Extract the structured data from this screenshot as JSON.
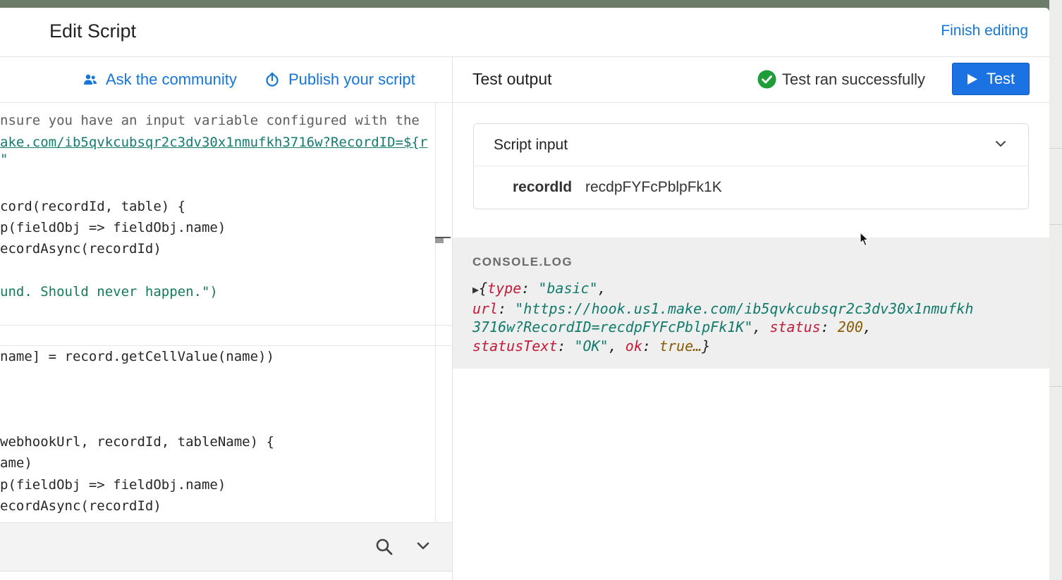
{
  "header": {
    "title": "Edit Script",
    "finish_label": "Finish editing"
  },
  "toolbar": {
    "community_label": "Ask the community",
    "publish_label": "Publish your script"
  },
  "code_lines": [
    "nsure you have an input variable configured with the",
    "ake.com/ib5qvkcubsqr2c3dv30x1nmufkh3716w?RecordID=${r",
    "\"",
    "cord(recordId, table) {",
    "p(fieldObj => fieldObj.name)",
    "ecordAsync(recordId)",
    "und. Should never happen.\")",
    "name] = record.getCellValue(name))",
    "webhookUrl, recordId, tableName) {",
    "ame)",
    "p(fieldObj => fieldObj.name)",
    "ecordAsync(recordId)"
  ],
  "output": {
    "title": "Test output",
    "status_text": "Test ran successfully",
    "test_button": "Test"
  },
  "script_input": {
    "title": "Script input",
    "var_name": "recordId",
    "var_value": "recdpFYFcPblpFk1K"
  },
  "console": {
    "label": "CONSOLE.LOG",
    "l1_open": "{",
    "l1_key": "type",
    "l1_colon": ": ",
    "l1_val": "\"basic\"",
    "l1_end": ",",
    "l2_key": "url",
    "l2_colon": ": ",
    "l2_val": "\"https://hook.us1.make.com/ib5qvkcubsqr2c3dv30x1nmufkh",
    "l3_val": "3716w?RecordID=recdpFYFcPblpFk1K\"",
    "l3_sep": ", ",
    "l3_key": "status",
    "l3_colon": ": ",
    "l3_num": "200",
    "l3_end": ",",
    "l4_key": "statusText",
    "l4_colon": ": ",
    "l4_val": "\"OK\"",
    "l4_sep": ", ",
    "l4_key2": "ok",
    "l4_colon2": ": ",
    "l4_val2": "true…",
    "l4_close": "}"
  },
  "colors": {
    "accent": "#1676d8",
    "button": "#1b72e2",
    "success": "#1f9d3a"
  },
  "icons": [
    "community-icon",
    "publish-icon",
    "check-circle-icon",
    "play-icon",
    "chevron-down-icon",
    "search-icon",
    "mouse-cursor-icon"
  ]
}
